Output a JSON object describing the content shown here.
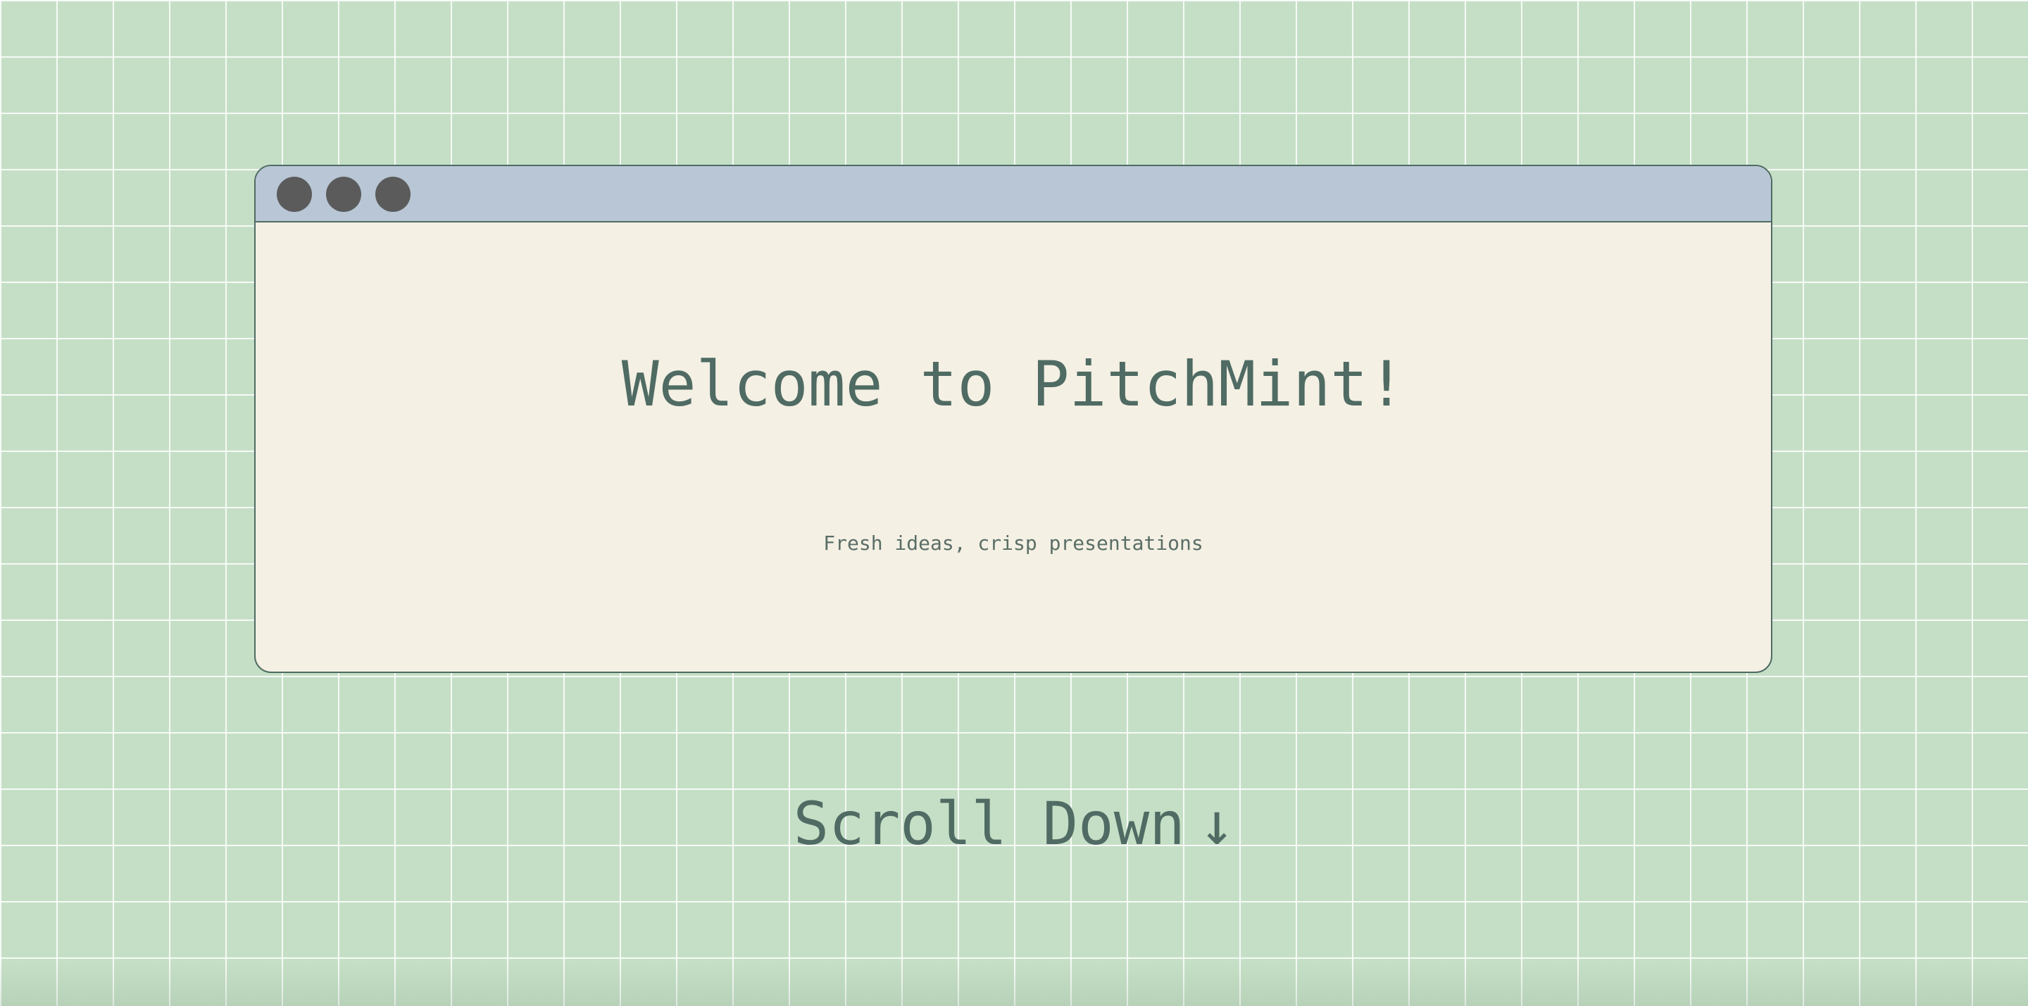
{
  "window": {
    "heading": "Welcome to PitchMint!",
    "tagline": "Fresh ideas, crisp presentations",
    "controls": [
      "close-dot",
      "minimize-dot",
      "maximize-dot"
    ]
  },
  "scroll_prompt": {
    "label": "Scroll Down",
    "arrow": "↓",
    "icon": "arrow-down-icon"
  },
  "colors": {
    "background": "#c5dfc6",
    "grid_lines": "#ffffff",
    "window_body": "#f4f0e4",
    "titlebar": "#b8c6d5",
    "window_dots": "#5b5b5b",
    "text": "#4f6b63"
  }
}
